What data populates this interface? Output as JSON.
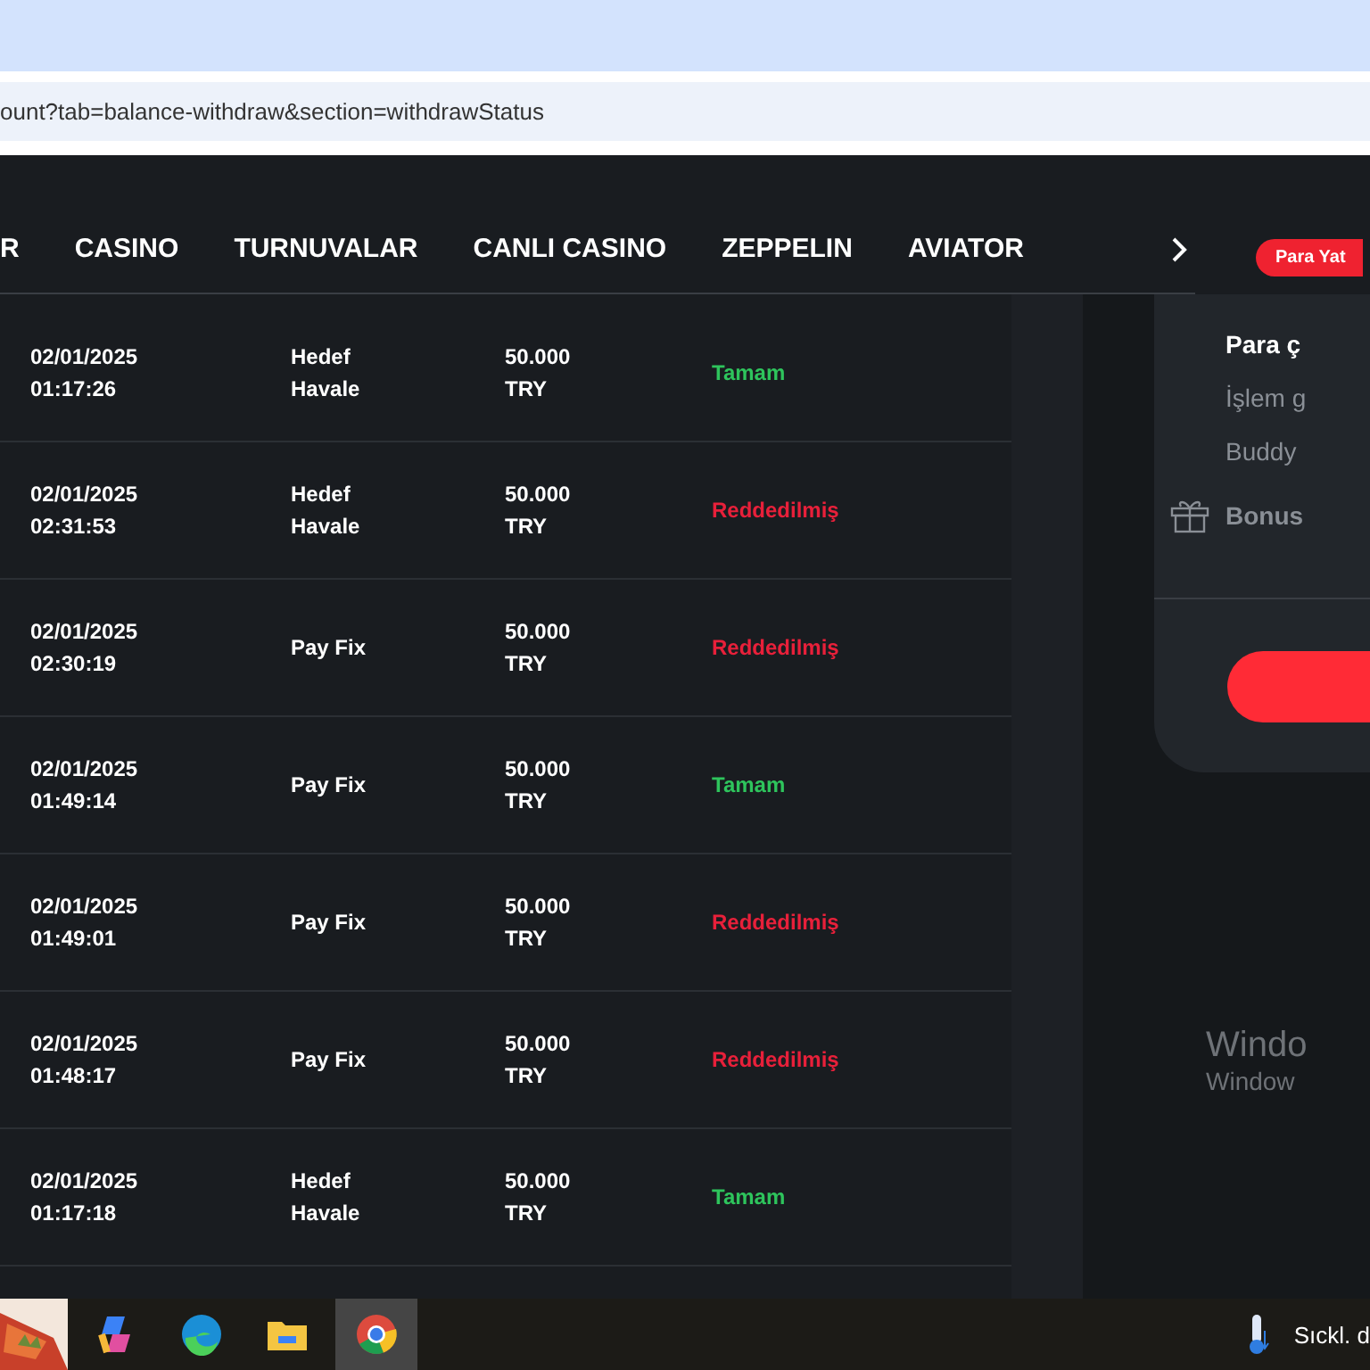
{
  "browser": {
    "url": "ount?tab=balance-withdraw&section=withdrawStatus"
  },
  "nav": {
    "items": [
      {
        "label": "R"
      },
      {
        "label": "CASINO"
      },
      {
        "label": "TURNUVALAR"
      },
      {
        "label": "CANLI CASINO"
      },
      {
        "label": "ZEPPELIN"
      },
      {
        "label": "AVIATOR"
      }
    ],
    "deposit_button": "Para Yat"
  },
  "withdrawals": [
    {
      "date": "02/01/2025",
      "time": "01:17:26",
      "method": "Hedef Havale",
      "amount": "50.000",
      "currency": "TRY",
      "status": {
        "text": "Tamam",
        "kind": "ok"
      }
    },
    {
      "date": "02/01/2025",
      "time": "02:31:53",
      "method": "Hedef Havale",
      "amount": "50.000",
      "currency": "TRY",
      "status": {
        "text": "Reddedilmiş",
        "kind": "rejected"
      }
    },
    {
      "date": "02/01/2025",
      "time": "02:30:19",
      "method": "Pay Fix",
      "amount": "50.000",
      "currency": "TRY",
      "status": {
        "text": "Reddedilmiş",
        "kind": "rejected"
      }
    },
    {
      "date": "02/01/2025",
      "time": "01:49:14",
      "method": "Pay Fix",
      "amount": "50.000",
      "currency": "TRY",
      "status": {
        "text": "Tamam",
        "kind": "ok"
      }
    },
    {
      "date": "02/01/2025",
      "time": "01:49:01",
      "method": "Pay Fix",
      "amount": "50.000",
      "currency": "TRY",
      "status": {
        "text": "Reddedilmiş",
        "kind": "rejected"
      }
    },
    {
      "date": "02/01/2025",
      "time": "01:48:17",
      "method": "Pay Fix",
      "amount": "50.000",
      "currency": "TRY",
      "status": {
        "text": "Reddedilmiş",
        "kind": "rejected"
      }
    },
    {
      "date": "02/01/2025",
      "time": "01:17:18",
      "method": "Hedef Havale",
      "amount": "50.000",
      "currency": "TRY",
      "status": {
        "text": "Tamam",
        "kind": "ok"
      }
    }
  ],
  "account_menu": {
    "items": [
      {
        "label": "Para ç",
        "selected": true
      },
      {
        "label": "İşlem g",
        "selected": false
      },
      {
        "label": "Buddy",
        "selected": false
      }
    ],
    "bonus": "Bonus"
  },
  "activation_notice": {
    "title": "Windo",
    "subtitle": "Window"
  },
  "taskbar": {
    "weather": "Sıckl. d"
  }
}
